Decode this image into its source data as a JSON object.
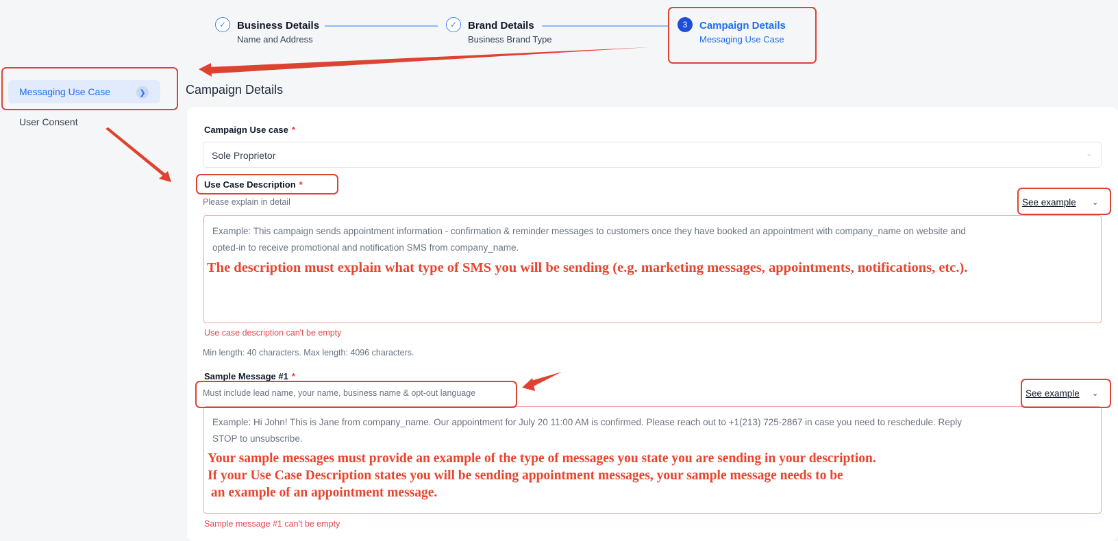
{
  "stepper": {
    "steps": [
      {
        "title": "Business Details",
        "subtitle": "Name and Address",
        "icon": "check-icon"
      },
      {
        "title": "Brand Details",
        "subtitle": "Business Brand Type",
        "icon": "check-icon"
      },
      {
        "number": "3",
        "title": "Campaign Details",
        "subtitle": "Messaging Use Case"
      }
    ]
  },
  "sidebar": {
    "items": [
      {
        "label": "Messaging Use Case",
        "active": true,
        "icon": "chevron-right-icon"
      },
      {
        "label": "User Consent",
        "active": false
      }
    ]
  },
  "page": {
    "title": "Campaign Details"
  },
  "form": {
    "campaign_use_case": {
      "label": "Campaign Use case",
      "required": "*",
      "value": "Sole Proprietor",
      "icon": "chevron-down-icon"
    },
    "use_case_description": {
      "label": "Use Case Description",
      "required": "*",
      "hint": "Please explain in detail",
      "see_example": "See example",
      "placeholder": "Example: This campaign sends appointment information - confirmation & reminder messages to customers once they have booked an appointment with company_name on website and opted-in to receive promotional and notification SMS from company_name.",
      "placeholder_line1": "Example: This campaign sends appointment information - confirmation & reminder messages to customers once they have booked an appointment with company_name on website and",
      "placeholder_line2": "opted-in to receive promotional and notification SMS from company_name.",
      "error": "Use case description can't be empty",
      "length_hint": "Min length: 40 characters. Max length: 4096 characters."
    },
    "sample_message_1": {
      "label": "Sample Message #1",
      "required": "*",
      "hint": "Must include lead name, your name, business name & opt-out language",
      "see_example": "See example",
      "placeholder_line1": "Example: Hi John! This is Jane from company_name. Our appointment for July 20 11:00 AM is confirmed. Please reach out to +1(213) 725-2867 in case you need to reschedule. Reply",
      "placeholder_line2": "STOP to unsubscribe.",
      "error": "Sample message #1 can't be empty"
    }
  },
  "annotations": {
    "description_note": "The description must explain what type of SMS you will be sending (e.g. marketing messages, appointments, notifications, etc.).",
    "sample_note_line1": "Your sample messages must provide an example of the type of messages you state you are sending in your description.",
    "sample_note_line2": "If your Use Case Description states you will be sending appointment messages, your sample message needs to be",
    "sample_note_line3": " an example of an appointment message."
  },
  "colors": {
    "accent": "#1d6ef0",
    "annotation_red": "#de4331",
    "error_red": "#e5484d"
  }
}
